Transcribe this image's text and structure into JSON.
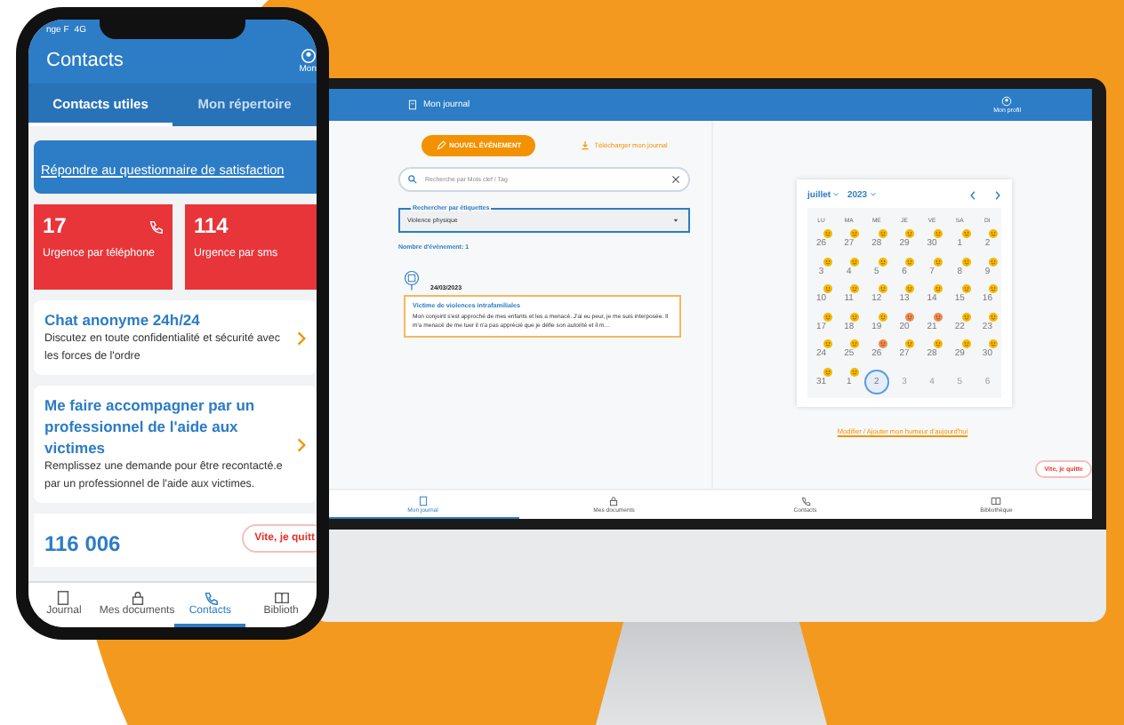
{
  "phone": {
    "status_bar": {
      "carrier": "nge F",
      "network": "4G"
    },
    "header": {
      "title": "Contacts",
      "profile_label": "Mon"
    },
    "tabs": [
      {
        "label": "Contacts utiles",
        "selected": true
      },
      {
        "label": "Mon répertoire",
        "selected": false
      }
    ],
    "survey_link": "Répondre au questionnaire de satisfaction",
    "emergency_cards": [
      {
        "number": "17",
        "label": "Urgence par téléphone",
        "kind": "phone"
      },
      {
        "number": "114",
        "label": "Urgence par sms",
        "kind": "sms"
      }
    ],
    "contact_cards": [
      {
        "title": "Chat anonyme 24h/24",
        "text": "Discutez en toute confidentialité et sécurité avec les forces de l'ordre"
      },
      {
        "title": "Me faire accompagner par un professionnel de l'aide aux victimes",
        "text": "Remplissez une demande pour être recontacté.e par un professionnel de l'aide aux victimes."
      }
    ],
    "number_card": "116 006",
    "quit_button": "Vite, je quitt",
    "nav": [
      {
        "label": "Journal",
        "kind": "journal",
        "selected": false
      },
      {
        "label": "Mes documents",
        "kind": "lock",
        "selected": false
      },
      {
        "label": "Contacts",
        "kind": "phone",
        "selected": true
      },
      {
        "label": "Biblioth",
        "kind": "book",
        "selected": false
      }
    ]
  },
  "desktop": {
    "header": {
      "title": "Mon journal",
      "profile_label": "Mon profil"
    },
    "new_event_button": "NOUVEL ÉVÉNEMENT",
    "download_link": "Télécharger mon journal",
    "search": {
      "placeholder": "Recherche par Mots clef / Tag"
    },
    "tag_select": {
      "legend": "Rechercher par étiquettes",
      "value": "Violence physique"
    },
    "event_count": "Nombre d'événement: 1",
    "events": [
      {
        "date": "24/03/2023",
        "title": "Victime de violences intrafamiliales",
        "text": "Mon conjoint s'est approché de mes enfants et les a menacé. J'ai eu peur, je me suis interposée. Il m'a menacé de me tuer il n'a pas apprécié que je défie son autorité et il m…"
      }
    ],
    "calendar": {
      "month": "juillet",
      "year": "2023",
      "weekdays": [
        "LU",
        "MA",
        "ME",
        "JE",
        "VE",
        "SA",
        "DI"
      ],
      "weeks": [
        [
          {
            "day": "26",
            "muted": false,
            "selected": false,
            "color": "#f5b800"
          },
          {
            "day": "27",
            "muted": false,
            "selected": false,
            "color": "#f5b800"
          },
          {
            "day": "28",
            "muted": false,
            "selected": false,
            "color": "#f5b800"
          },
          {
            "day": "29",
            "muted": false,
            "selected": false,
            "color": "#f5b800"
          },
          {
            "day": "30",
            "muted": false,
            "selected": false,
            "color": "#f5b800"
          },
          {
            "day": "1",
            "muted": false,
            "selected": false,
            "color": "#f5b800"
          },
          {
            "day": "2",
            "muted": false,
            "selected": false,
            "color": "#f5b800"
          }
        ],
        [
          {
            "day": "3",
            "muted": false,
            "selected": false,
            "color": "#f5b800"
          },
          {
            "day": "4",
            "muted": false,
            "selected": false,
            "color": "#f5b800"
          },
          {
            "day": "5",
            "muted": false,
            "selected": false,
            "color": "#f5b800"
          },
          {
            "day": "6",
            "muted": false,
            "selected": false,
            "color": "#f5b800"
          },
          {
            "day": "7",
            "muted": false,
            "selected": false,
            "color": "#f5b800"
          },
          {
            "day": "8",
            "muted": false,
            "selected": false,
            "color": "#f5b800"
          },
          {
            "day": "9",
            "muted": false,
            "selected": false,
            "color": "#f5b800"
          }
        ],
        [
          {
            "day": "10",
            "muted": false,
            "selected": false,
            "color": "#f5b800"
          },
          {
            "day": "11",
            "muted": false,
            "selected": false,
            "color": "#f5b800"
          },
          {
            "day": "12",
            "muted": false,
            "selected": false,
            "color": "#f5b800"
          },
          {
            "day": "13",
            "muted": false,
            "selected": false,
            "color": "#f5b800"
          },
          {
            "day": "14",
            "muted": false,
            "selected": false,
            "color": "#f5b800"
          },
          {
            "day": "15",
            "muted": false,
            "selected": false,
            "color": "#f5b800"
          },
          {
            "day": "16",
            "muted": false,
            "selected": false,
            "color": "#f5b800"
          }
        ],
        [
          {
            "day": "17",
            "muted": false,
            "selected": false,
            "color": "#f5b800"
          },
          {
            "day": "18",
            "muted": false,
            "selected": false,
            "color": "#f5b800"
          },
          {
            "day": "19",
            "muted": false,
            "selected": false,
            "color": "#f5b800"
          },
          {
            "day": "20",
            "muted": false,
            "selected": false,
            "color": "#f08a50"
          },
          {
            "day": "21",
            "muted": false,
            "selected": false,
            "color": "#f08a50"
          },
          {
            "day": "22",
            "muted": false,
            "selected": false,
            "color": "#f5b800"
          },
          {
            "day": "23",
            "muted": false,
            "selected": false,
            "color": "#f5b800"
          }
        ],
        [
          {
            "day": "24",
            "muted": false,
            "selected": false,
            "color": "#f5b800"
          },
          {
            "day": "25",
            "muted": false,
            "selected": false,
            "color": "#f5b800"
          },
          {
            "day": "26",
            "muted": false,
            "selected": false,
            "color": "#f08a50"
          },
          {
            "day": "27",
            "muted": false,
            "selected": false,
            "color": "#f5b800"
          },
          {
            "day": "28",
            "muted": false,
            "selected": false,
            "color": "#f5b800"
          },
          {
            "day": "29",
            "muted": false,
            "selected": false,
            "color": "#f5b800"
          },
          {
            "day": "30",
            "muted": false,
            "selected": false,
            "color": "#f5b800"
          }
        ],
        [
          {
            "day": "31",
            "muted": false,
            "selected": false,
            "color": "#f5b800"
          },
          {
            "day": "1",
            "muted": false,
            "selected": false,
            "color": "#f5b800"
          },
          {
            "day": "2",
            "muted": false,
            "selected": true
          },
          {
            "day": "3",
            "muted": true,
            "selected": false
          },
          {
            "day": "4",
            "muted": true,
            "selected": false
          },
          {
            "day": "5",
            "muted": true,
            "selected": false
          },
          {
            "day": "6",
            "muted": true,
            "selected": false
          }
        ]
      ]
    },
    "mood_link": "Modifier / Ajouter mon humeur d'aujourd'hui",
    "quit_button": "Vite, je quitte",
    "nav": [
      {
        "label": "Mon journal",
        "kind": "journal",
        "selected": true
      },
      {
        "label": "Mes documents",
        "kind": "lock",
        "selected": false
      },
      {
        "label": "Contacts",
        "kind": "phone",
        "selected": false
      },
      {
        "label": "Bibliothèque",
        "kind": "book",
        "selected": false
      }
    ]
  }
}
